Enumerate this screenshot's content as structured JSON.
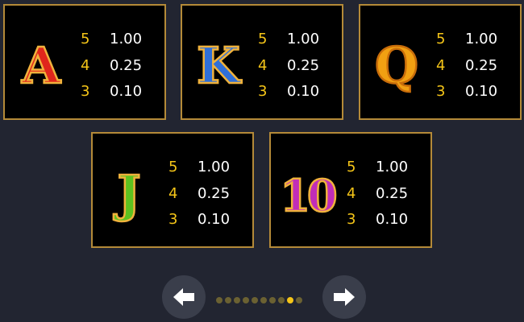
{
  "paytable": [
    {
      "id": "A",
      "symbol": "A",
      "color": "#e0261c",
      "rows": [
        {
          "count": "5",
          "amount": "1.00"
        },
        {
          "count": "4",
          "amount": "0.25"
        },
        {
          "count": "3",
          "amount": "0.10"
        }
      ]
    },
    {
      "id": "K",
      "symbol": "K",
      "color": "#2f6fd8",
      "rows": [
        {
          "count": "5",
          "amount": "1.00"
        },
        {
          "count": "4",
          "amount": "0.25"
        },
        {
          "count": "3",
          "amount": "0.10"
        }
      ]
    },
    {
      "id": "Q",
      "symbol": "Q",
      "color": "#f1a012",
      "rows": [
        {
          "count": "5",
          "amount": "1.00"
        },
        {
          "count": "4",
          "amount": "0.25"
        },
        {
          "count": "3",
          "amount": "0.10"
        }
      ]
    },
    {
      "id": "J",
      "symbol": "J",
      "color": "#5cc21f",
      "rows": [
        {
          "count": "5",
          "amount": "1.00"
        },
        {
          "count": "4",
          "amount": "0.25"
        },
        {
          "count": "3",
          "amount": "0.10"
        }
      ]
    },
    {
      "id": "10",
      "symbol": "10",
      "color": "#c12db8",
      "rows": [
        {
          "count": "5",
          "amount": "1.00"
        },
        {
          "count": "4",
          "amount": "0.25"
        },
        {
          "count": "3",
          "amount": "0.10"
        }
      ]
    }
  ],
  "pagination": {
    "total_pages": 10,
    "current_page": 9
  },
  "navigation": {
    "prev_icon": "arrow-left-icon",
    "next_icon": "arrow-right-icon"
  },
  "colors": {
    "background": "#222531",
    "card_border": "#b48a38",
    "count_text": "#f5c518",
    "amount_text": "#ffffff",
    "dot_inactive": "#6b6132",
    "dot_active": "#f5c518"
  }
}
